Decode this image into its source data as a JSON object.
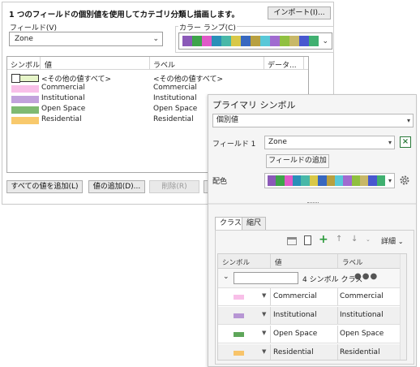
{
  "old_dialog": {
    "heading": "1 つのフィールドの個別値を使用してカテゴリ分類し描画します。",
    "import_button": "インポート(I)...",
    "field_label": "フィールド(V)",
    "field_value": "Zone",
    "color_ramp_label": "カラー ランプ(C)",
    "columns": [
      "シンボル",
      "値",
      "ラベル",
      "データ..."
    ],
    "rows": [
      {
        "value": "<その他の値すべて>",
        "label": "<その他の値すべて>",
        "color": "#e6f5c8",
        "outlined": true
      },
      {
        "value": "Commercial",
        "label": "Commercial",
        "color": "#f8bfe8",
        "outlined": false
      },
      {
        "value": "Institutional",
        "label": "Institutional",
        "color": "#c2a2dc",
        "outlined": false
      },
      {
        "value": "Open Space",
        "label": "Open Space",
        "color": "#7fba72",
        "outlined": false
      },
      {
        "value": "Residential",
        "label": "Residential",
        "color": "#f8c96c",
        "outlined": false
      }
    ],
    "buttons": {
      "add_all": "すべての値を追加(L)",
      "add_values": "値の追加(D)...",
      "remove": "削除(R)"
    }
  },
  "symbology_pane": {
    "title": "プライマリ シンボル",
    "method": "個別値",
    "field1_label": "フィールド 1",
    "field1_value": "Zone",
    "add_field_button": "フィールドの追加",
    "color_scheme_label": "配色",
    "tabs": [
      "クラス",
      "縮尺"
    ],
    "more_label": "詳細",
    "columns": [
      "シンボル",
      "値",
      "ラベル"
    ],
    "group_summary": "4 シンボル クラス",
    "classes": [
      {
        "value": "Commercial",
        "label": "Commercial",
        "color": "#f8bfe8"
      },
      {
        "value": "Institutional",
        "label": "Institutional",
        "color": "#b796d4"
      },
      {
        "value": "Open Space",
        "label": "Open Space",
        "color": "#5ea65a"
      },
      {
        "value": "Residential",
        "label": "Residential",
        "color": "#f8c46a"
      }
    ]
  },
  "ramp_colors": [
    "#8b59b8",
    "#3ea44a",
    "#e05ac8",
    "#2a8fb8",
    "#48b8a8",
    "#d8c848",
    "#3868c0",
    "#b8a040",
    "#58c8d8",
    "#a06bd0",
    "#90c040",
    "#c8b868",
    "#4858d0",
    "#40b070"
  ],
  "icons": {
    "excel": "excel-icon",
    "gear": "gear-icon",
    "add": "plus-icon",
    "more": "ellipsis-icon"
  }
}
